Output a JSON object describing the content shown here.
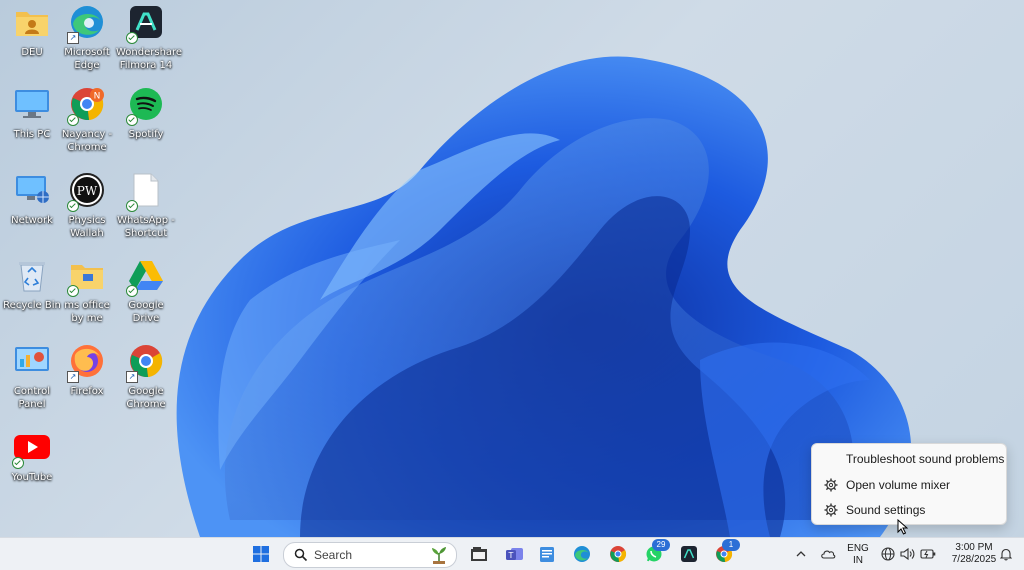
{
  "desktop": {
    "icons": [
      {
        "label": "DEU",
        "icon": "user-folder-icon"
      },
      {
        "label": "Microsoft Edge",
        "icon": "edge-icon"
      },
      {
        "label": "Wondershare Filmora 14",
        "icon": "filmora-icon"
      },
      {
        "label": "This PC",
        "icon": "monitor-icon"
      },
      {
        "label": "Nayancy - Chrome",
        "icon": "chrome-profile-icon",
        "badge": "N"
      },
      {
        "label": "Spotify",
        "icon": "spotify-icon"
      },
      {
        "label": "Network",
        "icon": "network-icon"
      },
      {
        "label": "Physics Wallah",
        "icon": "pw-icon",
        "badge": "PW"
      },
      {
        "label": "WhatsApp - Shortcut",
        "icon": "document-icon"
      },
      {
        "label": "Recycle Bin",
        "icon": "recycle-bin-icon"
      },
      {
        "label": "ms office by me",
        "icon": "folder-icon"
      },
      {
        "label": "Google Drive",
        "icon": "google-drive-icon"
      },
      {
        "label": "Control Panel",
        "icon": "control-panel-icon"
      },
      {
        "label": "Firefox",
        "icon": "firefox-icon"
      },
      {
        "label": "Google Chrome",
        "icon": "chrome-icon"
      },
      {
        "label": "YouTube",
        "icon": "youtube-icon"
      }
    ]
  },
  "context_menu": {
    "items": [
      {
        "label": "Troubleshoot sound problems",
        "icon": ""
      },
      {
        "label": "Open volume mixer",
        "icon": "gear-icon"
      },
      {
        "label": "Sound settings",
        "icon": "gear-icon"
      }
    ]
  },
  "taskbar": {
    "search_label": "Search",
    "apps": [
      {
        "name": "file-explorer-icon"
      },
      {
        "name": "teams-icon"
      },
      {
        "name": "notepad-icon"
      },
      {
        "name": "edge-icon"
      },
      {
        "name": "chrome-icon"
      },
      {
        "name": "whatsapp-icon",
        "badge": "29"
      },
      {
        "name": "filmora-icon"
      },
      {
        "name": "chrome-profile-icon",
        "badge": "1"
      }
    ],
    "tray": {
      "language_line1": "ENG",
      "language_line2": "IN",
      "time": "3:00 PM",
      "date": "7/28/2025"
    }
  },
  "colors": {
    "accent": "#1f6fe0",
    "wallpaper_bloom": "#1a5ee8",
    "taskbar": "#eef1f5"
  }
}
